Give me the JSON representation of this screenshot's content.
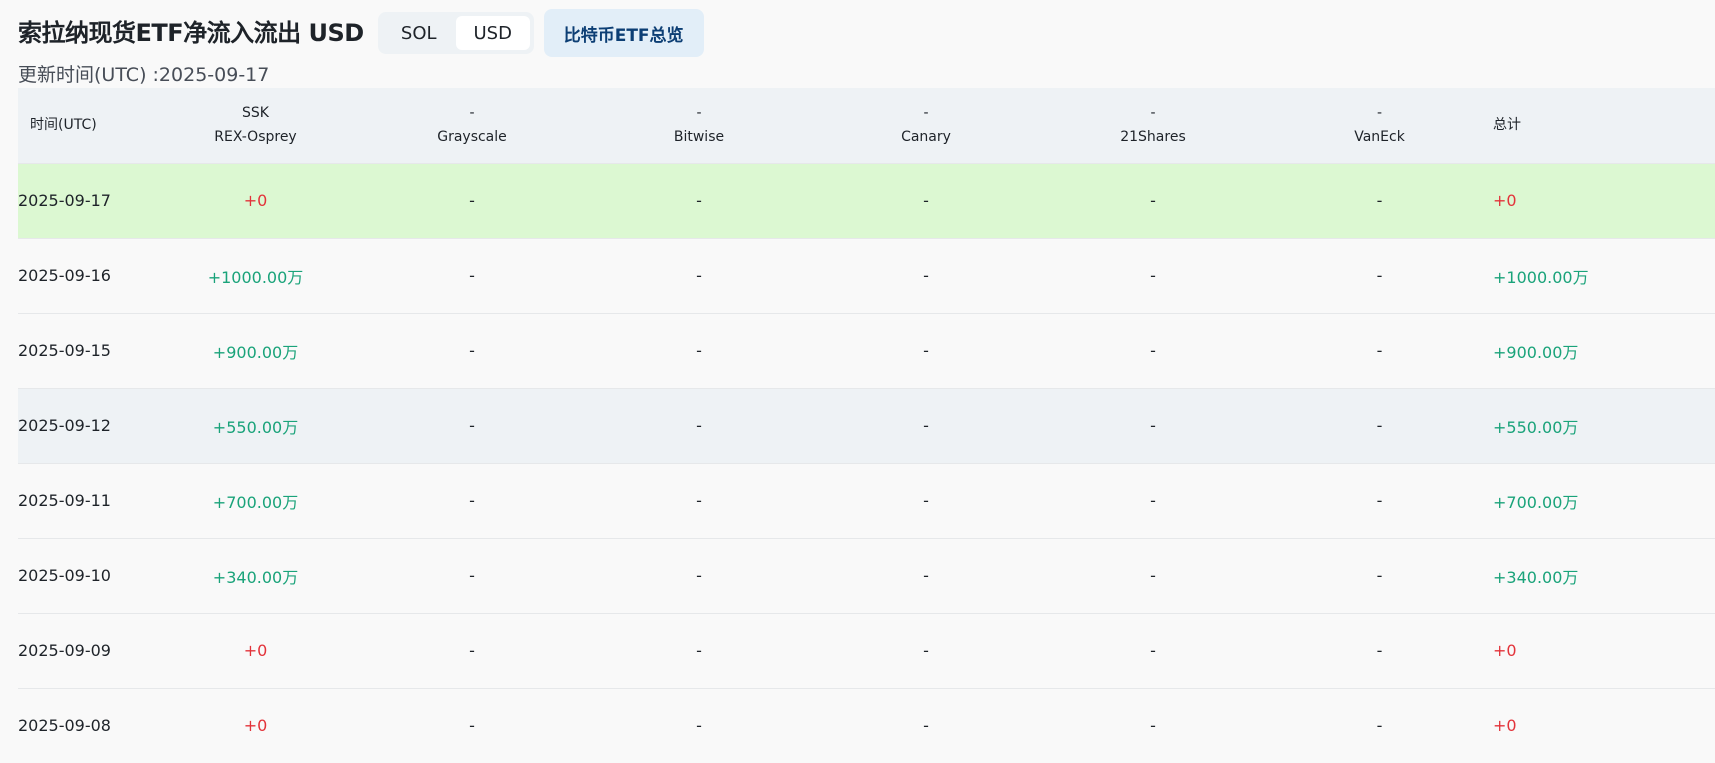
{
  "header": {
    "title": "索拉纳现货ETF净流入流出 USD",
    "toggle": [
      "SOL",
      "USD"
    ],
    "toggle_active": "USD",
    "btc_link": "比特币ETF总览",
    "update_time": "更新时间(UTC) :2025-09-17"
  },
  "table": {
    "columns": [
      {
        "top": "",
        "bottom": "时间(UTC)"
      },
      {
        "top": "SSK",
        "bottom": "REX-Osprey"
      },
      {
        "top": "-",
        "bottom": "Grayscale"
      },
      {
        "top": "-",
        "bottom": "Bitwise"
      },
      {
        "top": "-",
        "bottom": "Canary"
      },
      {
        "top": "-",
        "bottom": "21Shares"
      },
      {
        "top": "-",
        "bottom": "VanEck"
      },
      {
        "top": "",
        "bottom": "总计"
      }
    ],
    "rows": [
      {
        "date": "2025-09-17",
        "ssk": "+0",
        "grayscale": "-",
        "bitwise": "-",
        "canary": "-",
        "shares21": "-",
        "vaneck": "-",
        "total": "+0"
      },
      {
        "date": "2025-09-16",
        "ssk": "+1000.00万",
        "grayscale": "-",
        "bitwise": "-",
        "canary": "-",
        "shares21": "-",
        "vaneck": "-",
        "total": "+1000.00万"
      },
      {
        "date": "2025-09-15",
        "ssk": "+900.00万",
        "grayscale": "-",
        "bitwise": "-",
        "canary": "-",
        "shares21": "-",
        "vaneck": "-",
        "total": "+900.00万"
      },
      {
        "date": "2025-09-12",
        "ssk": "+550.00万",
        "grayscale": "-",
        "bitwise": "-",
        "canary": "-",
        "shares21": "-",
        "vaneck": "-",
        "total": "+550.00万"
      },
      {
        "date": "2025-09-11",
        "ssk": "+700.00万",
        "grayscale": "-",
        "bitwise": "-",
        "canary": "-",
        "shares21": "-",
        "vaneck": "-",
        "total": "+700.00万"
      },
      {
        "date": "2025-09-10",
        "ssk": "+340.00万",
        "grayscale": "-",
        "bitwise": "-",
        "canary": "-",
        "shares21": "-",
        "vaneck": "-",
        "total": "+340.00万"
      },
      {
        "date": "2025-09-09",
        "ssk": "+0",
        "grayscale": "-",
        "bitwise": "-",
        "canary": "-",
        "shares21": "-",
        "vaneck": "-",
        "total": "+0"
      },
      {
        "date": "2025-09-08",
        "ssk": "+0",
        "grayscale": "-",
        "bitwise": "-",
        "canary": "-",
        "shares21": "-",
        "vaneck": "-",
        "total": "+0"
      }
    ]
  },
  "colors": {
    "positive": "#1aa37a",
    "zero": "#e3333a",
    "highlight_row": "#dcf8d2",
    "header_bg": "#eef2f5",
    "link_bg": "#e2eef8",
    "link_text": "#0c3e74"
  }
}
